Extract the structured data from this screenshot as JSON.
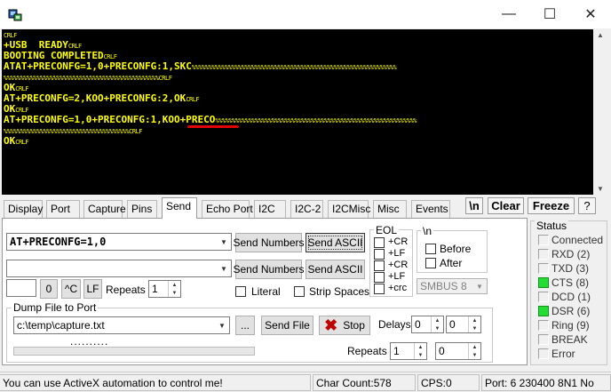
{
  "window": {
    "minimize_glyph": "—",
    "maximize_glyph": "☐",
    "close_glyph": "✕"
  },
  "terminal": {
    "lines": [
      {
        "text": "",
        "ctl": "CRLF"
      },
      {
        "text": "+USB  READY",
        "ctl": "CRLF"
      },
      {
        "text": "BOOTING COMPLETED",
        "ctl": "CRLF"
      },
      {
        "text": "ATAT+PRECONFG=1,0+PRECONFG:1,SKC",
        "ctl": "%%%%%%%%%%%%%%%%%%%%%%%%%%%%%%%%%%%%%%%%%%%%%%%%%%%%%%%%%%%%%%"
      },
      {
        "text": "",
        "ctl": "%%%%%%%%%%%%%%%%%%%%%%%%%%%%%%%%%%%%%%%%%%%%%%%CRLF"
      },
      {
        "text": "OK",
        "ctl": "CRLF"
      },
      {
        "text": "AT+PRECONFG=2,KOO+PRECONFG:2,OK",
        "ctl": "CRLF"
      },
      {
        "text": "OK",
        "ctl": "CRLF"
      },
      {
        "text": "AT+PRECONFG=1,0+PRECONFG:1,KOO+PRECO",
        "ctl": "%%%%%%%%%%%%%%%%%%%%%%%%%%%%%%%%%%%%%%%%%%%%%%%%%%%%%%%%%%%%%"
      },
      {
        "text": "",
        "ctl": "%%%%%%%%%%%%%%%%%%%%%%%%%%%%%%%%%%%%%%CRLF"
      },
      {
        "text": "OK",
        "ctl": "CRLF"
      }
    ]
  },
  "tabs": [
    {
      "label": "Display",
      "name": "tab-display"
    },
    {
      "label": "Port",
      "name": "tab-port"
    },
    {
      "label": "Capture",
      "name": "tab-capture"
    },
    {
      "label": "Pins",
      "name": "tab-pins"
    },
    {
      "label": "Send",
      "name": "tab-send"
    },
    {
      "label": "Echo Port",
      "name": "tab-echo-port"
    },
    {
      "label": "I2C",
      "name": "tab-i2c"
    },
    {
      "label": "I2C-2",
      "name": "tab-i2c-2"
    },
    {
      "label": "I2CMisc",
      "name": "tab-i2cmisc"
    },
    {
      "label": "Misc",
      "name": "tab-misc"
    },
    {
      "label": "Events",
      "name": "tab-events"
    }
  ],
  "right_buttons": {
    "newline": "\\n",
    "clear": "Clear",
    "freeze": "Freeze",
    "help": "?"
  },
  "send": {
    "input1": "AT+PRECONFG=1,0",
    "input2": "",
    "send_numbers": "Send Numbers",
    "send_ascii": "Send ASCII",
    "numeric_value": "0",
    "ctrl_c": "^C",
    "lf": "LF",
    "repeats_label": "Repeats",
    "repeats_value": "1",
    "literal": "Literal",
    "strip_spaces": "Strip Spaces",
    "eol_title": "EOL",
    "eol_options": [
      "+CR",
      "+LF",
      "+CR",
      "+LF",
      "+crc"
    ],
    "nl_title": "\\n",
    "before": "Before",
    "after": "After",
    "smbus": "SMBUS 8"
  },
  "dump": {
    "title": "Dump File to Port",
    "path": "c:\\temp\\capture.txt",
    "browse": "...",
    "send_file": "Send File",
    "stop": "Stop",
    "delays_label": "Delays",
    "delay1": "0",
    "delay2": "0",
    "repeats_label": "Repeats",
    "repeats1": "1",
    "repeats2": "0",
    "progress_dots": "..........",
    "progress": 0
  },
  "status": {
    "title": "Status",
    "items": [
      {
        "label": "Connected",
        "on": false
      },
      {
        "label": "RXD (2)",
        "on": false
      },
      {
        "label": "TXD (3)",
        "on": false
      },
      {
        "label": "CTS (8)",
        "on": true
      },
      {
        "label": "DCD (1)",
        "on": false
      },
      {
        "label": "DSR (6)",
        "on": true
      },
      {
        "label": "Ring (9)",
        "on": false
      },
      {
        "label": "BREAK",
        "on": false
      },
      {
        "label": "Error",
        "on": false
      }
    ]
  },
  "statusbar": {
    "message": "You can use ActiveX automation to control me!",
    "char_count": "Char Count:578",
    "cps": "CPS:0",
    "port": "Port: 6 230400 8N1 No"
  }
}
